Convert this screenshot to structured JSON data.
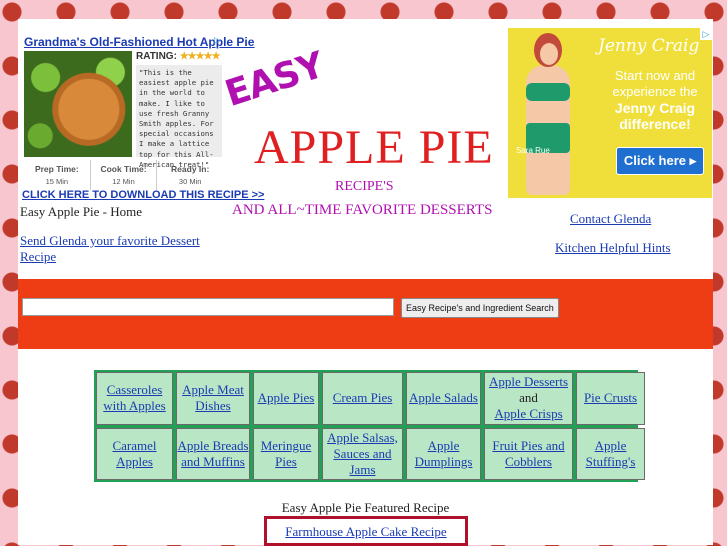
{
  "ad_left": {
    "title": "Grandma's Old-Fashioned Hot Apple Pie",
    "rating_label": "RATING:",
    "stars": "★★★★★",
    "quote": "\"This is the easiest apple pie in the world to make. I like to use fresh Granny Smith apples. For special occasions I make a lattice top for this All-American treat!\"",
    "times": [
      {
        "label": "Prep Time:",
        "value": "15 Min"
      },
      {
        "label": "Cook Time:",
        "value": "12 Min"
      },
      {
        "label": "Ready In:",
        "value": "30 Min"
      }
    ],
    "cta": "CLICK HERE TO DOWNLOAD THIS RECIPE >>"
  },
  "logo": {
    "easy": "EASY",
    "apple_pie": "APPLE PIE",
    "recipes": "RECIPE'S",
    "tagline": "AND ALL~TIME FAVORITE DESSERTS"
  },
  "ad_right": {
    "brand": "Jenny Craig",
    "line1": "Start now and",
    "line2": "experience the",
    "line3": "Jenny Craig",
    "line4": "difference!",
    "model_name": "Sara Rue",
    "button": "Click here ▸"
  },
  "nav": {
    "home": "Easy Apple Pie - Home",
    "send": "Send Glenda your favorite Dessert Recipe",
    "contact": "Contact Glenda",
    "hints": "Kitchen Helpful Hints"
  },
  "search": {
    "placeholder": "",
    "button": "Easy Recipe's and Ingredient Search"
  },
  "categories": {
    "row1": {
      "c1": "Casseroles with Apples",
      "c2": "Apple Meat Dishes",
      "c3": "Apple Pies",
      "c4": "Cream Pies",
      "c5": "Apple Salads",
      "c6a": "Apple Desserts",
      "c6and": "and",
      "c6b": "Apple Crisps",
      "c7": "Pie Crusts"
    },
    "row2": {
      "c1": "Caramel Apples",
      "c2": "Apple Breads and Muffins",
      "c3": "Meringue Pies",
      "c4": "Apple Salsas, Sauces and Jams",
      "c5": "Apple Dumplings",
      "c6": "Fruit Pies and Cobblers",
      "c7": "Apple Stuffing's"
    }
  },
  "featured": {
    "title": "Easy Apple Pie Featured Recipe",
    "link": "Farmhouse Apple Cake Recipe"
  },
  "colors": {
    "search_band": "#ee3c14",
    "category_border": "#22a055",
    "category_cell": "#b9e6c4",
    "link": "#1a3bb3",
    "logo_magenta": "#b010b0",
    "logo_red": "#e02020"
  }
}
